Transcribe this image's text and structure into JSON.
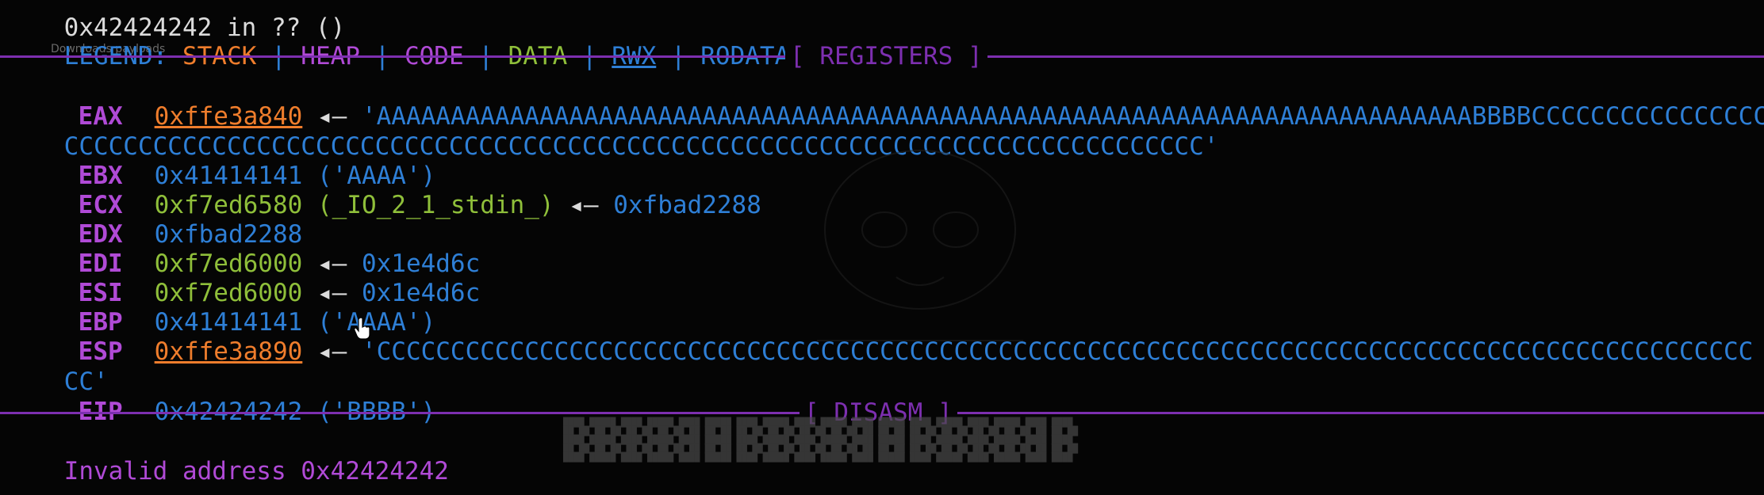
{
  "top_partial": "0x42424242 in ?? ()",
  "legend": {
    "label": "LEGEND: ",
    "stack": "STACK",
    "heap": "HEAP",
    "code": "CODE",
    "data": "DATA",
    "rwx": "RWX",
    "rodata": "RODATA",
    "sep": " | "
  },
  "overlay_ghost": "Downloads  payloads",
  "sections": {
    "registers": "[ REGISTERS ]",
    "disasm": "[ DISASM ]"
  },
  "registers": [
    {
      "name": "EAX",
      "addr": "0xffe3a840",
      "addr_color": "orange",
      "underline": true,
      "arrow": " ◂— ",
      "rest": "'AAAAAAAAAAAAAAAAAAAAAAAAAAAAAAAAAAAAAAAAAAAAAAAAAAAAAAAAAAAAAAAAAAAAAAAAAABBBBCCCCCCCCCCCCCCCC",
      "rest_color": "blue"
    },
    {
      "name": "EBX",
      "addr": "0x41414141",
      "addr_color": "blue",
      "underline": false,
      "arrow": "",
      "rest": " ('AAAA')",
      "rest_color": "blue"
    },
    {
      "name": "ECX",
      "addr": "0xf7ed6580",
      "addr_color": "green",
      "underline": false,
      "arrow": "",
      "rest": " (_IO_2_1_stdin_)",
      "rest_color": "green",
      "arrow2": " ◂— ",
      "rest2": "0xfbad2288"
    },
    {
      "name": "EDX",
      "addr": "0xfbad2288",
      "addr_color": "blue",
      "underline": false,
      "arrow": "",
      "rest": "",
      "rest_color": "blue"
    },
    {
      "name": "EDI",
      "addr": "0xf7ed6000",
      "addr_color": "green",
      "underline": false,
      "arrow": " ◂— ",
      "rest": "0x1e4d6c",
      "rest_color": "blue"
    },
    {
      "name": "ESI",
      "addr": "0xf7ed6000",
      "addr_color": "green",
      "underline": false,
      "arrow": " ◂— ",
      "rest": "0x1e4d6c",
      "rest_color": "blue"
    },
    {
      "name": "EBP",
      "addr": "0x41414141",
      "addr_color": "blue",
      "underline": false,
      "arrow": "",
      "rest": " ('AAAA')",
      "rest_color": "blue"
    },
    {
      "name": "ESP",
      "addr": "0xffe3a890",
      "addr_color": "orange",
      "underline": true,
      "arrow": " ◂— ",
      "rest": "'CCCCCCCCCCCCCCCCCCCCCCCCCCCCCCCCCCCCCCCCCCCCCCCCCCCCCCCCCCCCCCCCCCCCCCCCCCCCCCCCCCCCCCCCCCCCC",
      "rest_color": "blue"
    },
    {
      "name": "EIP",
      "addr": "0x42424242",
      "addr_color": "blue",
      "underline": false,
      "arrow": "",
      "rest": " ('BBBB')",
      "rest_color": "blue"
    }
  ],
  "wraps": {
    "eax": "CCCCCCCCCCCCCCCCCCCCCCCCCCCCCCCCCCCCCCCCCCCCCCCCCCCCCCCCCCCCCCCCCCCCCCCCCCCCC'",
    "esp": "CC'"
  },
  "disasm_text": "Invalid address 0x42424242",
  "colors": {
    "blue": "#2e7fd6",
    "orange": "#ef7d2c",
    "purple": "#b04ad6",
    "green": "#8fbf3a",
    "separator": "#7d2fb0",
    "background": "#050505"
  },
  "icons": {
    "cursor": "hand-pointer-icon"
  }
}
